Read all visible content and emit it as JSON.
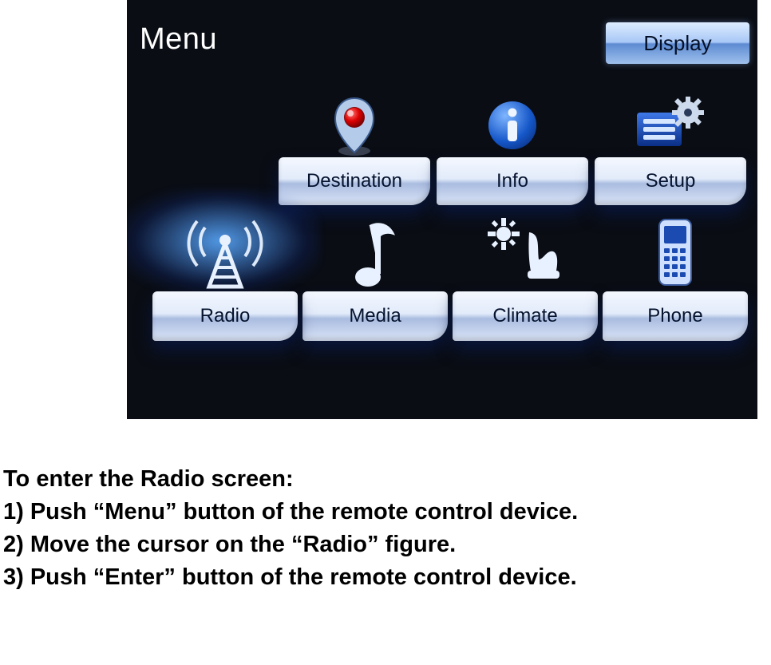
{
  "screen": {
    "title": "Menu",
    "display_button": "Display",
    "row1": [
      {
        "label": "Destination",
        "icon": "pin"
      },
      {
        "label": "Info",
        "icon": "info"
      },
      {
        "label": "Setup",
        "icon": "gear"
      }
    ],
    "row2": [
      {
        "label": "Radio",
        "icon": "tower",
        "selected": true
      },
      {
        "label": "Media",
        "icon": "note"
      },
      {
        "label": "Climate",
        "icon": "seat"
      },
      {
        "label": "Phone",
        "icon": "phone"
      }
    ]
  },
  "instructions": {
    "heading": "To enter the Radio screen:",
    "steps": [
      "1) Push “Menu” button of the remote control device.",
      "2) Move the cursor on the “Radio” figure.",
      "3) Push “Enter” button of the remote control device."
    ]
  }
}
